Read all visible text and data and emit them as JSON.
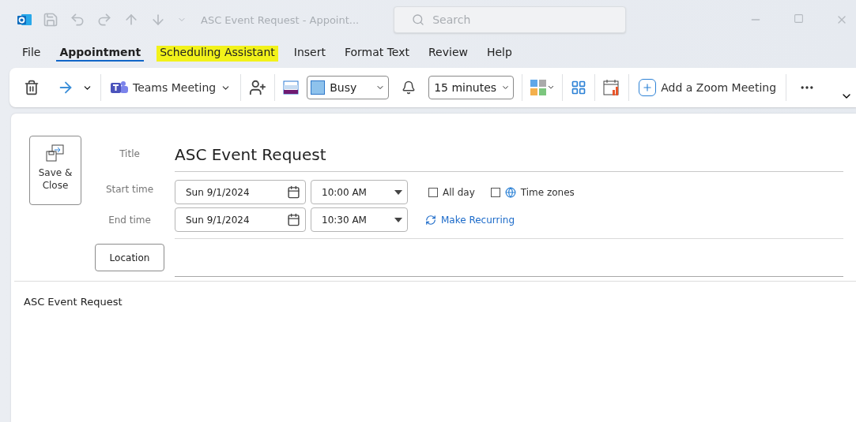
{
  "window": {
    "title": "ASC Event Request  -  Appoint...",
    "search_placeholder": "Search"
  },
  "tabs": [
    {
      "label": "File",
      "selected": false,
      "highlighted": false
    },
    {
      "label": "Appointment",
      "selected": true,
      "highlighted": false
    },
    {
      "label": "Scheduling Assistant",
      "selected": false,
      "highlighted": true
    },
    {
      "label": "Insert",
      "selected": false,
      "highlighted": false
    },
    {
      "label": "Format Text",
      "selected": false,
      "highlighted": false
    },
    {
      "label": "Review",
      "selected": false,
      "highlighted": false
    },
    {
      "label": "Help",
      "selected": false,
      "highlighted": false
    }
  ],
  "toolbar": {
    "teams_meeting": "Teams Meeting",
    "show_as": "Busy",
    "reminder": "15 minutes",
    "zoom": "Add a Zoom Meeting"
  },
  "form": {
    "save_close": "Save &\nClose",
    "title_label": "Title",
    "title_value": "ASC Event Request",
    "start_label": "Start time",
    "start_date": "Sun 9/1/2024",
    "start_time": "10:00 AM",
    "end_label": "End time",
    "end_date": "Sun 9/1/2024",
    "end_time": "10:30 AM",
    "all_day": {
      "label": "All day",
      "checked": false
    },
    "time_zones": {
      "label": "Time zones",
      "checked": false
    },
    "make_recurring": "Make Recurring",
    "location_button": "Location"
  },
  "body": "ASC Event Request"
}
